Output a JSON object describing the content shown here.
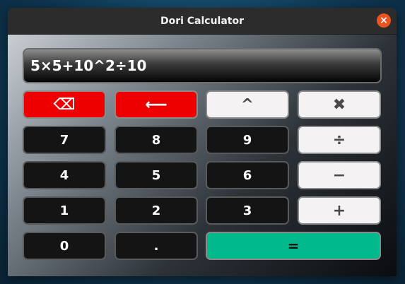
{
  "window": {
    "title": "Dori Calculator",
    "close_glyph": "×"
  },
  "display": {
    "expression": "5×5+10^2÷10"
  },
  "keypad": {
    "backspace": "⌫",
    "left": "⟵",
    "power": "^",
    "multiply": "✖",
    "seven": "7",
    "eight": "8",
    "nine": "9",
    "divide": "÷",
    "four": "4",
    "five": "5",
    "six": "6",
    "minus": "−",
    "one": "1",
    "two": "2",
    "three": "3",
    "plus": "+",
    "zero": "0",
    "dot": ".",
    "equals": "="
  },
  "colors": {
    "close": "#e95420",
    "red_keys": "#ee0000",
    "equals_key": "#00b98c",
    "dark_keys": "#141414",
    "light_keys": "#f4f2f2"
  },
  "icons": {
    "backspace": "backspace-icon",
    "left": "left-arrow-icon",
    "close": "close-icon"
  }
}
